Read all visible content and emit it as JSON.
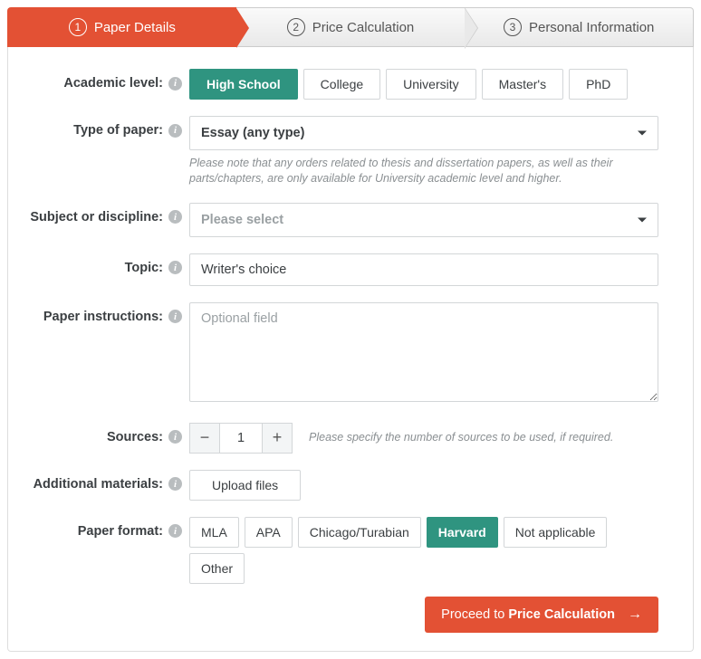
{
  "steps": [
    {
      "num": "1",
      "label": "Paper Details",
      "active": true
    },
    {
      "num": "2",
      "label": "Price Calculation",
      "active": false
    },
    {
      "num": "3",
      "label": "Personal Information",
      "active": false
    }
  ],
  "labels": {
    "academic_level": "Academic level:",
    "type_of_paper": "Type of paper:",
    "subject": "Subject or discipline:",
    "topic": "Topic:",
    "instructions": "Paper instructions:",
    "sources": "Sources:",
    "materials": "Additional materials:",
    "format": "Paper format:"
  },
  "academic_level": {
    "options": [
      "High School",
      "College",
      "University",
      "Master's",
      "PhD"
    ],
    "selected": "High School"
  },
  "type_of_paper": {
    "value": "Essay (any type)",
    "hint": "Please note that any orders related to thesis and dissertation papers, as well as their parts/chapters, are only available for University academic level and higher."
  },
  "subject": {
    "placeholder": "Please select"
  },
  "topic": {
    "value": "Writer's choice"
  },
  "instructions": {
    "placeholder": "Optional field",
    "value": ""
  },
  "sources": {
    "value": "1",
    "hint": "Please specify the number of sources to be used, if required."
  },
  "materials": {
    "button": "Upload files"
  },
  "paper_format": {
    "options": [
      "MLA",
      "APA",
      "Chicago/Turabian",
      "Harvard",
      "Not applicable",
      "Other"
    ],
    "selected": "Harvard"
  },
  "proceed": {
    "prefix": "Proceed to ",
    "bold": "Price Calculation"
  }
}
